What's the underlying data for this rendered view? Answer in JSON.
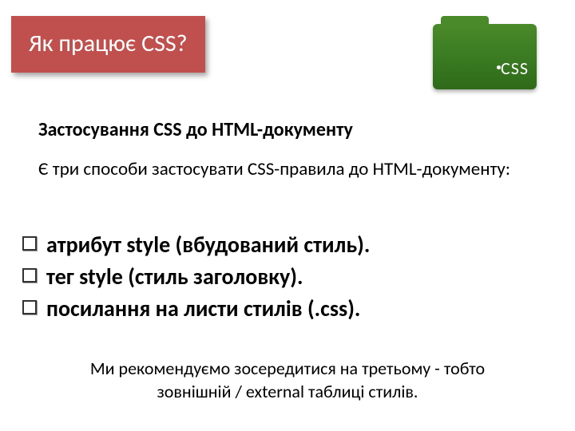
{
  "title": "Як працює CSS?",
  "icon_label": "CSS",
  "subtitle": "Застосування CSS до HTML-документу",
  "intro": "Є три способи застосувати CSS-правила до HTML-документу:",
  "bullets": [
    "атрибут style (вбудований стиль).",
    " тег style (стиль заголовку).",
    "посилання на листи стилів (.css)."
  ],
  "footer": "Ми рекомендуємо зосередитися на третьому - тобто зовнішній / external таблиці стилів."
}
